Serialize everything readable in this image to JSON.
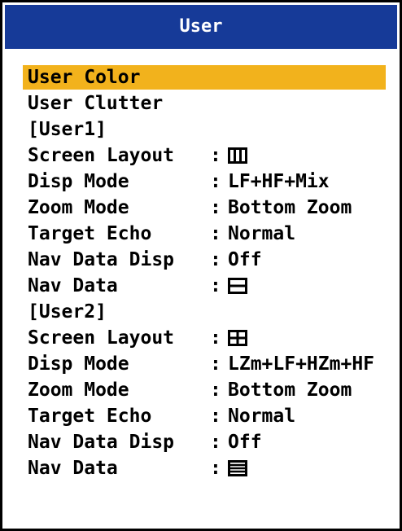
{
  "title": "User",
  "menu": {
    "items": [
      {
        "label": "User Color",
        "selected": true
      },
      {
        "label": "User Clutter"
      }
    ],
    "user1": {
      "header": "[User1]",
      "screen_layout": {
        "label": "Screen Layout",
        "colon": ":",
        "icon": "three-column-layout-icon"
      },
      "disp_mode": {
        "label": "Disp Mode",
        "colon": ":",
        "value": "LF+HF+Mix"
      },
      "zoom_mode": {
        "label": "Zoom Mode",
        "colon": ":",
        "value": "Bottom Zoom"
      },
      "target_echo": {
        "label": "Target Echo",
        "colon": ":",
        "value": "Normal"
      },
      "nav_data_disp": {
        "label": "Nav Data Disp",
        "colon": ":",
        "value": "Off"
      },
      "nav_data": {
        "label": "Nav Data",
        "colon": ":",
        "icon": "two-row-nav-data-icon"
      }
    },
    "user2": {
      "header": "[User2]",
      "screen_layout": {
        "label": "Screen Layout",
        "colon": ":",
        "icon": "quad-layout-icon"
      },
      "disp_mode": {
        "label": "Disp Mode",
        "colon": ":",
        "value": "LZm+LF+HZm+HF"
      },
      "zoom_mode": {
        "label": "Zoom Mode",
        "colon": ":",
        "value": "Bottom Zoom"
      },
      "target_echo": {
        "label": "Target Echo",
        "colon": ":",
        "value": "Normal"
      },
      "nav_data_disp": {
        "label": "Nav Data Disp",
        "colon": ":",
        "value": "Off"
      },
      "nav_data": {
        "label": "Nav Data",
        "colon": ":",
        "icon": "four-row-nav-data-icon"
      }
    }
  },
  "colors": {
    "title_bar": "#163a98",
    "selection": "#f2b21c"
  }
}
